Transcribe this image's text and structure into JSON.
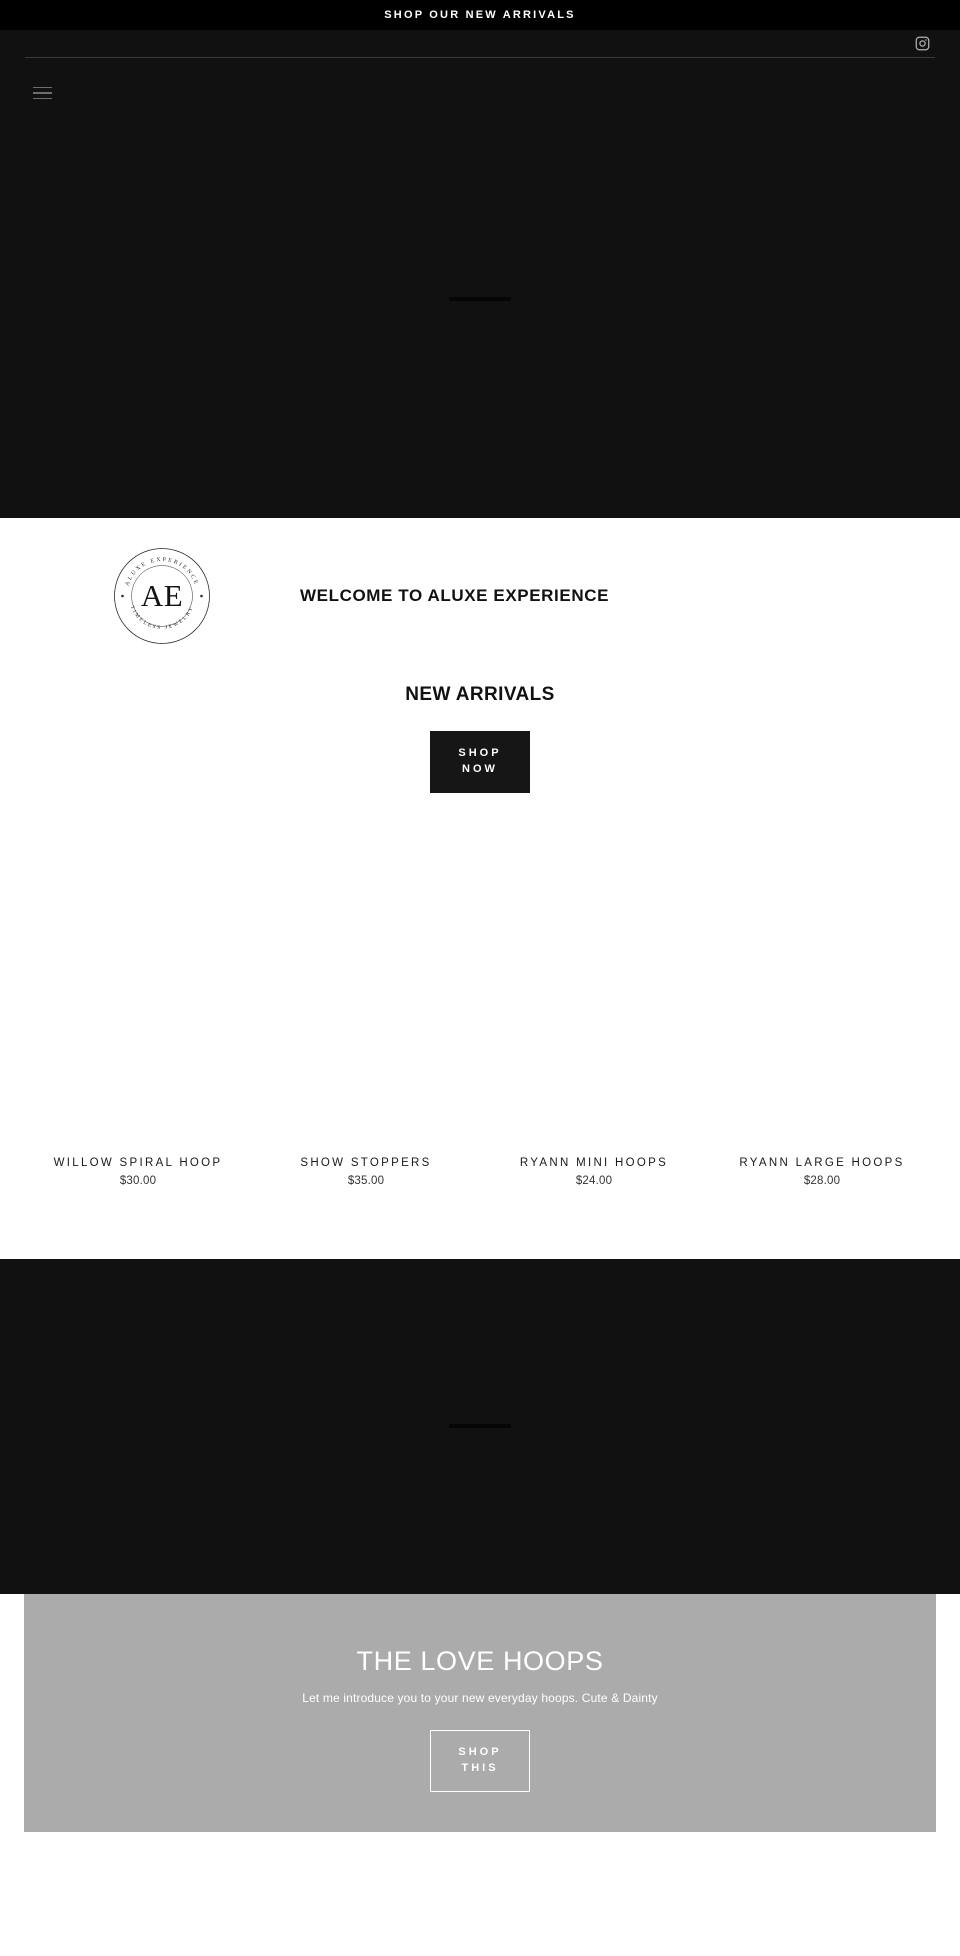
{
  "announcement": {
    "text": "SHOP OUR NEW ARRIVALS"
  },
  "header": {
    "menu_icon": "hamburger-menu-icon",
    "social": [
      {
        "name": "instagram-icon",
        "label": "Instagram"
      }
    ]
  },
  "hero": {
    "background_color": "#111111"
  },
  "welcome": {
    "logo": {
      "top_arc_text": "ALUXE EXPERIENCE",
      "bottom_arc_text": "TIMELESS JEWELRY",
      "monogram": "AE"
    },
    "title": "WELCOME TO ALUXE EXPERIENCE"
  },
  "new_arrivals": {
    "heading": "NEW ARRIVALS",
    "cta": {
      "line1": "SHOP",
      "line2": "NOW"
    },
    "products": [
      {
        "title": "WILLOW SPIRAL HOOP",
        "price": "$30.00"
      },
      {
        "title": "SHOW STOPPERS",
        "price": "$35.00"
      },
      {
        "title": "RYANN MINI HOOPS",
        "price": "$24.00"
      },
      {
        "title": "RYANN LARGE HOOPS",
        "price": "$28.00"
      }
    ]
  },
  "dark_band": {
    "background_color": "#111111"
  },
  "promo": {
    "title": "THE LOVE HOOPS",
    "subtitle": "Let me introduce you to your new everyday hoops. Cute & Dainty",
    "background_color": "#ababab",
    "cta": {
      "line1": "SHOP",
      "line2": "THIS"
    }
  },
  "colors": {
    "announcement_bg": "#000000",
    "header_bg": "#111111",
    "dark_section_bg": "#111111",
    "button_solid_bg": "#161616",
    "promo_bg": "#ababab",
    "page_bg": "#ffffff"
  }
}
